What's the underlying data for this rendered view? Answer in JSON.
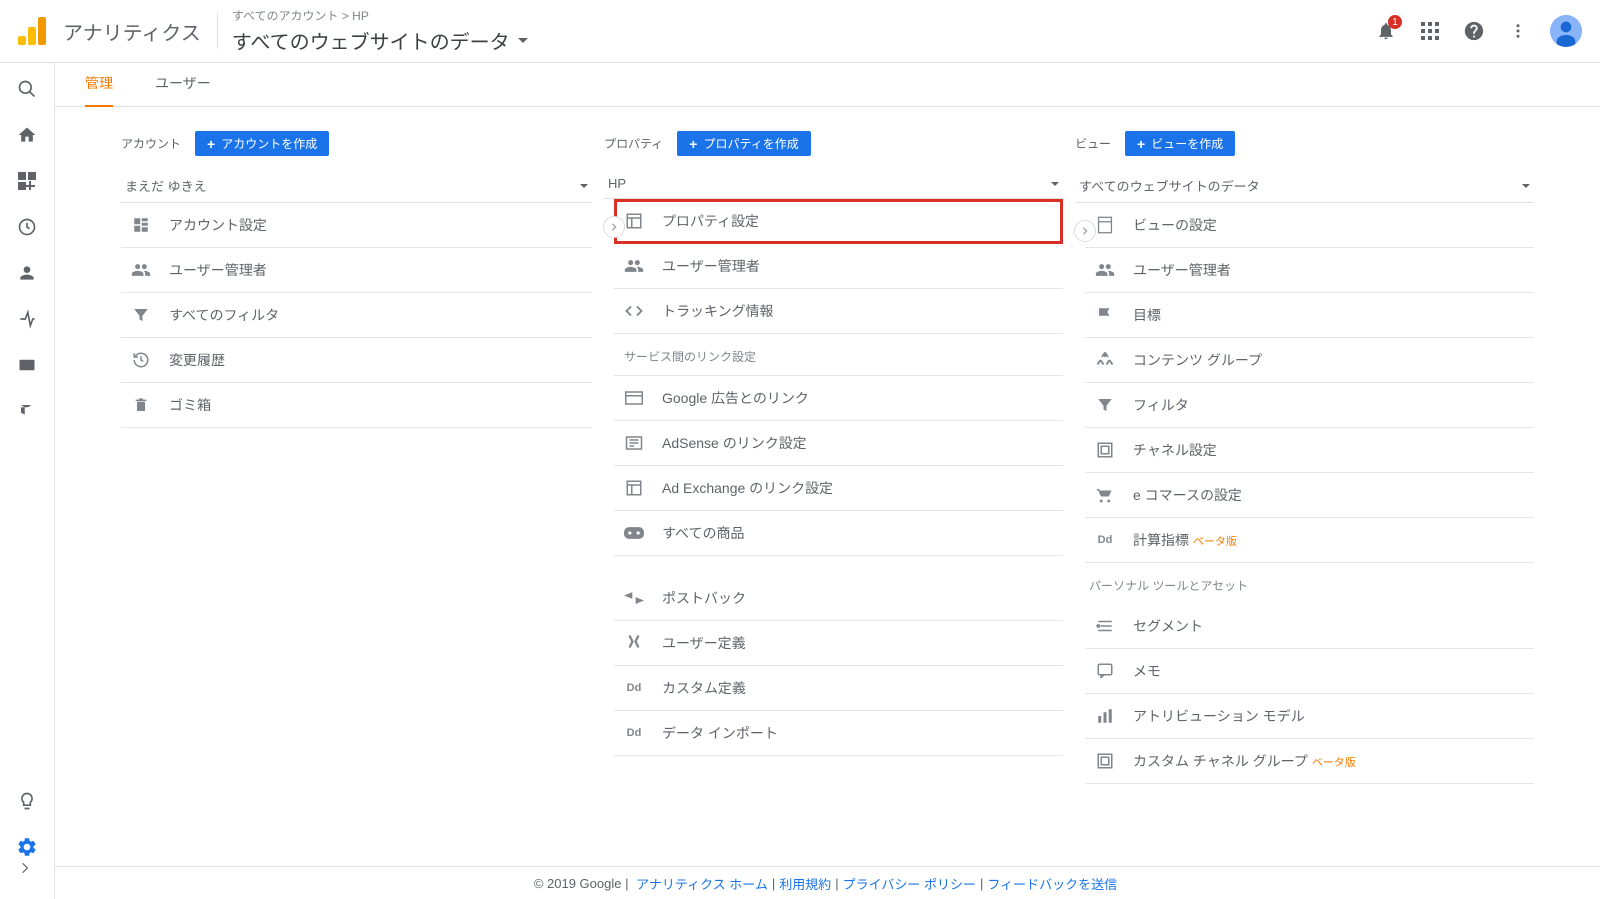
{
  "header": {
    "app_title": "アナリティクス",
    "breadcrumb_top": "すべてのアカウント > HP",
    "breadcrumb_title": "すべてのウェブサイトのデータ",
    "notification_count": "1"
  },
  "tabs": {
    "admin": "管理",
    "user": "ユーザー"
  },
  "columns": {
    "account": {
      "label": "アカウント",
      "create": "アカウントを作成",
      "select": "まえだ ゆきえ",
      "items": [
        {
          "icon": "account-settings-icon",
          "text": "アカウント設定"
        },
        {
          "icon": "people-icon",
          "text": "ユーザー管理者"
        },
        {
          "icon": "filter-icon",
          "text": "すべてのフィルタ"
        },
        {
          "icon": "history-icon",
          "text": "変更履歴"
        },
        {
          "icon": "trash-icon",
          "text": "ゴミ箱"
        }
      ]
    },
    "property": {
      "label": "プロパティ",
      "create": "プロパティを作成",
      "select": "HP",
      "items": [
        {
          "icon": "property-settings-icon",
          "text": "プロパティ設定",
          "highlight": true
        },
        {
          "icon": "people-icon",
          "text": "ユーザー管理者"
        },
        {
          "icon": "code-icon",
          "text": "トラッキング情報"
        }
      ],
      "section1_label": "サービス間のリンク設定",
      "section1_items": [
        {
          "icon": "ads-icon",
          "text": "Google 広告とのリンク"
        },
        {
          "icon": "adsense-icon",
          "text": "AdSense のリンク設定"
        },
        {
          "icon": "adx-icon",
          "text": "Ad Exchange のリンク設定"
        },
        {
          "icon": "products-icon",
          "text": "すべての商品"
        }
      ],
      "extra_items": [
        {
          "icon": "postback-icon",
          "text": "ポストバック"
        },
        {
          "icon": "userdef-icon",
          "text": "ユーザー定義"
        },
        {
          "icon": "dd-icon",
          "text": "カスタム定義"
        },
        {
          "icon": "dd-icon",
          "text": "データ インポート"
        }
      ]
    },
    "view": {
      "label": "ビュー",
      "create": "ビューを作成",
      "select": "すべてのウェブサイトのデータ",
      "items": [
        {
          "icon": "view-settings-icon",
          "text": "ビューの設定"
        },
        {
          "icon": "people-icon",
          "text": "ユーザー管理者"
        },
        {
          "icon": "flag-icon",
          "text": "目標"
        },
        {
          "icon": "content-group-icon",
          "text": "コンテンツ グループ"
        },
        {
          "icon": "filter-icon",
          "text": "フィルタ"
        },
        {
          "icon": "channel-icon",
          "text": "チャネル設定"
        },
        {
          "icon": "cart-icon",
          "text": "e コマースの設定"
        },
        {
          "icon": "dd-icon",
          "text": "計算指標",
          "beta": "ベータ版"
        }
      ],
      "section1_label": "パーソナル ツールとアセット",
      "section1_items": [
        {
          "icon": "segment-icon",
          "text": "セグメント"
        },
        {
          "icon": "memo-icon",
          "text": "メモ"
        },
        {
          "icon": "attribution-icon",
          "text": "アトリビューション モデル"
        },
        {
          "icon": "channel-icon",
          "text": "カスタム チャネル グループ",
          "beta": "ベータ版"
        }
      ]
    }
  },
  "footer": {
    "copy": "© 2019 Google",
    "links": [
      "アナリティクス ホーム",
      "利用規約",
      "プライバシー ポリシー",
      "フィードバックを送信"
    ]
  }
}
